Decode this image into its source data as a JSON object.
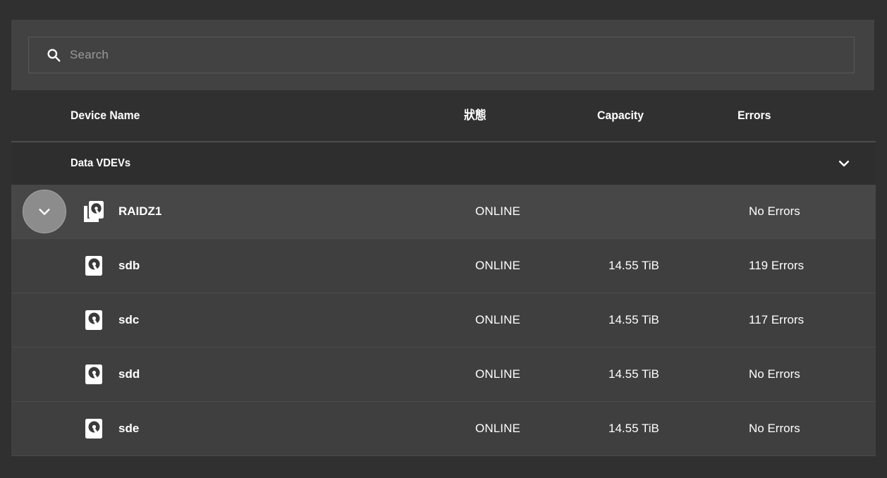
{
  "search": {
    "placeholder": "Search",
    "value": "",
    "icon": "search-icon"
  },
  "table": {
    "columns": [
      {
        "key": "name",
        "label": "Device Name"
      },
      {
        "key": "status",
        "label": "狀態"
      },
      {
        "key": "capacity",
        "label": "Capacity"
      },
      {
        "key": "errors",
        "label": "Errors"
      }
    ],
    "groups": [
      {
        "label": "Data VDEVs",
        "expanded": true,
        "chevron_icon": "chevron-down-icon"
      }
    ],
    "rows": [
      {
        "name": "RAIDZ1",
        "status": "ONLINE",
        "capacity": "",
        "errors": "No Errors",
        "icon": "multiple-disks-icon",
        "expand_icon": "chevron-down-icon",
        "has_expand_button": true,
        "highlighted": true,
        "level": 1
      },
      {
        "name": "sdb",
        "status": "ONLINE",
        "capacity": "14.55 TiB",
        "errors": "119 Errors",
        "icon": "hard-disk-icon",
        "has_expand_button": false,
        "highlighted": false,
        "level": 2
      },
      {
        "name": "sdc",
        "status": "ONLINE",
        "capacity": "14.55 TiB",
        "errors": "117 Errors",
        "icon": "hard-disk-icon",
        "has_expand_button": false,
        "highlighted": false,
        "level": 2
      },
      {
        "name": "sdd",
        "status": "ONLINE",
        "capacity": "14.55 TiB",
        "errors": "No Errors",
        "icon": "hard-disk-icon",
        "has_expand_button": false,
        "highlighted": false,
        "level": 2
      },
      {
        "name": "sde",
        "status": "ONLINE",
        "capacity": "14.55 TiB",
        "errors": "No Errors",
        "icon": "hard-disk-icon",
        "has_expand_button": false,
        "highlighted": false,
        "level": 2
      }
    ]
  },
  "colors": {
    "page_background": "#303030",
    "panel_background": "#424242",
    "row_background": "#3f3f3f",
    "row_background_hover": "#474747",
    "group_background": "#2e2e2e",
    "text_primary": "#ffffff",
    "text_placeholder": "#9a9a9a",
    "expand_button": "#8c8c8c",
    "border": "#4a4a4a"
  }
}
